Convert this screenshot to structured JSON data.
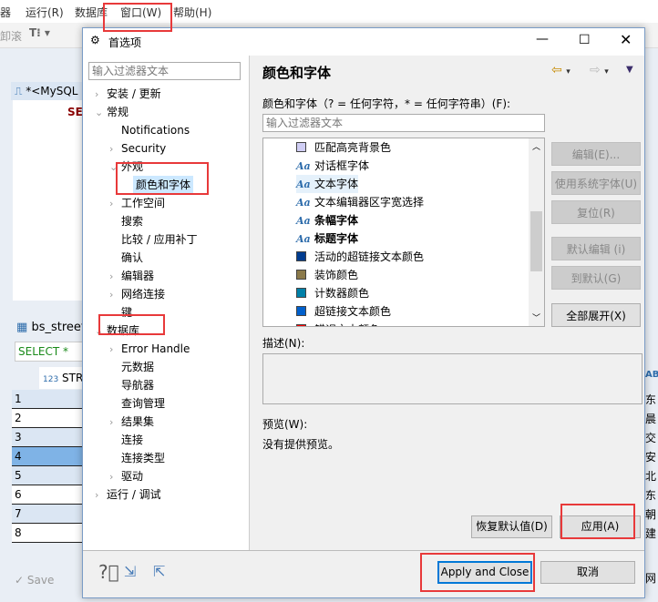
{
  "app": {
    "menu": [
      "器",
      "运行(R)",
      "数据库",
      "窗口(W)",
      "帮助(H)"
    ],
    "toolbar_text": "卸滚",
    "editor_tab": "*<MySQL",
    "editor_text": "SE",
    "results_tab": "bs_street",
    "sql_line": "SELECT *",
    "col_header": "STR",
    "rows": [
      "1",
      "2",
      "3",
      "4",
      "5",
      "6",
      "7",
      "8"
    ],
    "save_label": "Save",
    "right_col_header": "ABC",
    "right_cells": [
      "东",
      "晨",
      "交",
      "安",
      "北",
      "东",
      "朝",
      "建"
    ],
    "right_bottom": "网"
  },
  "dialog": {
    "title": "首选项",
    "filter_placeholder": "输入过滤器文本",
    "tree": [
      {
        "label": "安装 / 更新",
        "level": 0,
        "arrow": "right"
      },
      {
        "label": "常规",
        "level": 0,
        "arrow": "down"
      },
      {
        "label": "Notifications",
        "level": 1
      },
      {
        "label": "Security",
        "level": 1,
        "arrow": "right"
      },
      {
        "label": "外观",
        "level": 1,
        "arrow": "down"
      },
      {
        "label": "颜色和字体",
        "level": 2,
        "selected": true
      },
      {
        "label": "工作空间",
        "level": 1,
        "arrow": "right"
      },
      {
        "label": "搜索",
        "level": 1
      },
      {
        "label": "比较 / 应用补丁",
        "level": 1
      },
      {
        "label": "确认",
        "level": 1
      },
      {
        "label": "编辑器",
        "level": 1,
        "arrow": "right"
      },
      {
        "label": "网络连接",
        "level": 1,
        "arrow": "right"
      },
      {
        "label": "键",
        "level": 1
      },
      {
        "label": "数据库",
        "level": 0,
        "arrow": "down"
      },
      {
        "label": "Error Handle",
        "level": 1,
        "arrow": "right"
      },
      {
        "label": "元数据",
        "level": 1
      },
      {
        "label": "导航器",
        "level": 1
      },
      {
        "label": "查询管理",
        "level": 1
      },
      {
        "label": "结果集",
        "level": 1,
        "arrow": "right"
      },
      {
        "label": "连接",
        "level": 1
      },
      {
        "label": "连接类型",
        "level": 1
      },
      {
        "label": "驱动",
        "level": 1,
        "arrow": "right"
      },
      {
        "label": "运行 / 调试",
        "level": 0,
        "arrow": "right"
      }
    ],
    "page_title": "颜色和字体",
    "filter_label": "颜色和字体（? = 任何字符，* = 任何字符串）(F):",
    "list_filter_placeholder": "输入过滤器文本",
    "list": [
      {
        "label": "匹配高亮背景色",
        "type": "color",
        "color": "#d0cef5"
      },
      {
        "label": "对话框字体",
        "type": "font"
      },
      {
        "label": "文本字体",
        "type": "font",
        "selected": true
      },
      {
        "label": "文本编辑器区字宽选择",
        "type": "font"
      },
      {
        "label": "条幅字体",
        "type": "font",
        "bold": true
      },
      {
        "label": "标题字体",
        "type": "font",
        "bold": true
      },
      {
        "label": "活动的超链接文本颜色",
        "type": "color",
        "color": "#003c8f"
      },
      {
        "label": "装饰颜色",
        "type": "color",
        "color": "#8b7a4a"
      },
      {
        "label": "计数器颜色",
        "type": "color",
        "color": "#0080a8"
      },
      {
        "label": "超链接文本颜色",
        "type": "color",
        "color": "#0060cc"
      },
      {
        "label": "错误文本颜色",
        "type": "color",
        "color": "#ff0000"
      }
    ],
    "side_buttons": [
      "编辑(E)...",
      "使用系统字体(U)",
      "复位(R)",
      "默认编辑 (i)",
      "到默认(G)",
      "全部展开(X)"
    ],
    "desc_label": "描述(N):",
    "preview_label": "预览(W):",
    "preview_text": "没有提供预览。",
    "restore_defaults": "恢复默认值(D)",
    "apply": "应用(A)",
    "apply_close": "Apply and Close",
    "cancel": "取消",
    "accent": "#0078d7",
    "highlight": "#e8393a"
  }
}
